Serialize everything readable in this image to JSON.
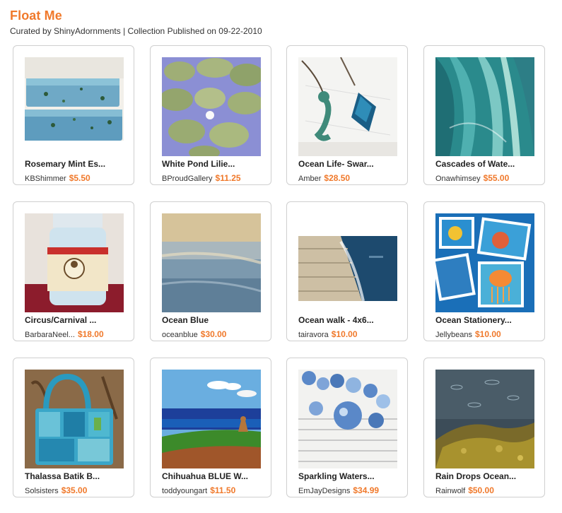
{
  "collection": {
    "title": "Float Me",
    "subtitle": "Curated by ShinyAdornments | Collection Published on 09-22-2010"
  },
  "items": [
    {
      "name": "Rosemary Mint Es...",
      "shop": "KBShimmer",
      "price": "$5.50"
    },
    {
      "name": "White Pond Lilie...",
      "shop": "BProudGallery",
      "price": "$11.25"
    },
    {
      "name": "Ocean Life- Swar...",
      "shop": "Amber",
      "price": "$28.50"
    },
    {
      "name": "Cascades of Wate...",
      "shop": "Onawhimsey",
      "price": "$55.00"
    },
    {
      "name": "Circus/Carnival ...",
      "shop": "BarbaraNeel...",
      "price": "$18.00"
    },
    {
      "name": "Ocean Blue",
      "shop": "oceanblue",
      "price": "$30.00"
    },
    {
      "name": "Ocean walk - 4x6...",
      "shop": "tairavora",
      "price": "$10.00"
    },
    {
      "name": "Ocean Stationery...",
      "shop": "Jellybeans",
      "price": "$10.00"
    },
    {
      "name": "Thalassa Batik B...",
      "shop": "Solsisters",
      "price": "$35.00"
    },
    {
      "name": "Chihuahua BLUE W...",
      "shop": "toddyoungart",
      "price": "$11.50"
    },
    {
      "name": "Sparkling Waters...",
      "shop": "EmJayDesigns",
      "price": "$34.99"
    },
    {
      "name": "Rain Drops Ocean...",
      "shop": "Rainwolf",
      "price": "$50.00"
    }
  ],
  "colors": {
    "accent": "#f0792b",
    "border": "#cfcfcf",
    "text": "#222222"
  }
}
